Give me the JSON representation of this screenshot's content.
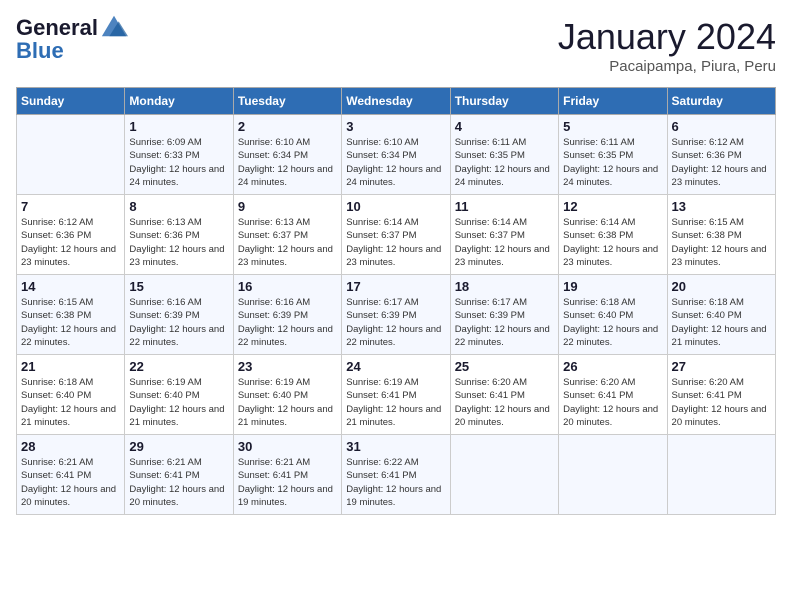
{
  "logo": {
    "general": "General",
    "blue": "Blue"
  },
  "title": "January 2024",
  "subtitle": "Pacaipampa, Piura, Peru",
  "days_of_week": [
    "Sunday",
    "Monday",
    "Tuesday",
    "Wednesday",
    "Thursday",
    "Friday",
    "Saturday"
  ],
  "weeks": [
    [
      {
        "day": "",
        "info": ""
      },
      {
        "day": "1",
        "info": "Sunrise: 6:09 AM\nSunset: 6:33 PM\nDaylight: 12 hours and 24 minutes."
      },
      {
        "day": "2",
        "info": "Sunrise: 6:10 AM\nSunset: 6:34 PM\nDaylight: 12 hours and 24 minutes."
      },
      {
        "day": "3",
        "info": "Sunrise: 6:10 AM\nSunset: 6:34 PM\nDaylight: 12 hours and 24 minutes."
      },
      {
        "day": "4",
        "info": "Sunrise: 6:11 AM\nSunset: 6:35 PM\nDaylight: 12 hours and 24 minutes."
      },
      {
        "day": "5",
        "info": "Sunrise: 6:11 AM\nSunset: 6:35 PM\nDaylight: 12 hours and 24 minutes."
      },
      {
        "day": "6",
        "info": "Sunrise: 6:12 AM\nSunset: 6:36 PM\nDaylight: 12 hours and 23 minutes."
      }
    ],
    [
      {
        "day": "7",
        "info": "Sunrise: 6:12 AM\nSunset: 6:36 PM\nDaylight: 12 hours and 23 minutes."
      },
      {
        "day": "8",
        "info": "Sunrise: 6:13 AM\nSunset: 6:36 PM\nDaylight: 12 hours and 23 minutes."
      },
      {
        "day": "9",
        "info": "Sunrise: 6:13 AM\nSunset: 6:37 PM\nDaylight: 12 hours and 23 minutes."
      },
      {
        "day": "10",
        "info": "Sunrise: 6:14 AM\nSunset: 6:37 PM\nDaylight: 12 hours and 23 minutes."
      },
      {
        "day": "11",
        "info": "Sunrise: 6:14 AM\nSunset: 6:37 PM\nDaylight: 12 hours and 23 minutes."
      },
      {
        "day": "12",
        "info": "Sunrise: 6:14 AM\nSunset: 6:38 PM\nDaylight: 12 hours and 23 minutes."
      },
      {
        "day": "13",
        "info": "Sunrise: 6:15 AM\nSunset: 6:38 PM\nDaylight: 12 hours and 23 minutes."
      }
    ],
    [
      {
        "day": "14",
        "info": "Sunrise: 6:15 AM\nSunset: 6:38 PM\nDaylight: 12 hours and 22 minutes."
      },
      {
        "day": "15",
        "info": "Sunrise: 6:16 AM\nSunset: 6:39 PM\nDaylight: 12 hours and 22 minutes."
      },
      {
        "day": "16",
        "info": "Sunrise: 6:16 AM\nSunset: 6:39 PM\nDaylight: 12 hours and 22 minutes."
      },
      {
        "day": "17",
        "info": "Sunrise: 6:17 AM\nSunset: 6:39 PM\nDaylight: 12 hours and 22 minutes."
      },
      {
        "day": "18",
        "info": "Sunrise: 6:17 AM\nSunset: 6:39 PM\nDaylight: 12 hours and 22 minutes."
      },
      {
        "day": "19",
        "info": "Sunrise: 6:18 AM\nSunset: 6:40 PM\nDaylight: 12 hours and 22 minutes."
      },
      {
        "day": "20",
        "info": "Sunrise: 6:18 AM\nSunset: 6:40 PM\nDaylight: 12 hours and 21 minutes."
      }
    ],
    [
      {
        "day": "21",
        "info": "Sunrise: 6:18 AM\nSunset: 6:40 PM\nDaylight: 12 hours and 21 minutes."
      },
      {
        "day": "22",
        "info": "Sunrise: 6:19 AM\nSunset: 6:40 PM\nDaylight: 12 hours and 21 minutes."
      },
      {
        "day": "23",
        "info": "Sunrise: 6:19 AM\nSunset: 6:40 PM\nDaylight: 12 hours and 21 minutes."
      },
      {
        "day": "24",
        "info": "Sunrise: 6:19 AM\nSunset: 6:41 PM\nDaylight: 12 hours and 21 minutes."
      },
      {
        "day": "25",
        "info": "Sunrise: 6:20 AM\nSunset: 6:41 PM\nDaylight: 12 hours and 20 minutes."
      },
      {
        "day": "26",
        "info": "Sunrise: 6:20 AM\nSunset: 6:41 PM\nDaylight: 12 hours and 20 minutes."
      },
      {
        "day": "27",
        "info": "Sunrise: 6:20 AM\nSunset: 6:41 PM\nDaylight: 12 hours and 20 minutes."
      }
    ],
    [
      {
        "day": "28",
        "info": "Sunrise: 6:21 AM\nSunset: 6:41 PM\nDaylight: 12 hours and 20 minutes."
      },
      {
        "day": "29",
        "info": "Sunrise: 6:21 AM\nSunset: 6:41 PM\nDaylight: 12 hours and 20 minutes."
      },
      {
        "day": "30",
        "info": "Sunrise: 6:21 AM\nSunset: 6:41 PM\nDaylight: 12 hours and 19 minutes."
      },
      {
        "day": "31",
        "info": "Sunrise: 6:22 AM\nSunset: 6:41 PM\nDaylight: 12 hours and 19 minutes."
      },
      {
        "day": "",
        "info": ""
      },
      {
        "day": "",
        "info": ""
      },
      {
        "day": "",
        "info": ""
      }
    ]
  ]
}
